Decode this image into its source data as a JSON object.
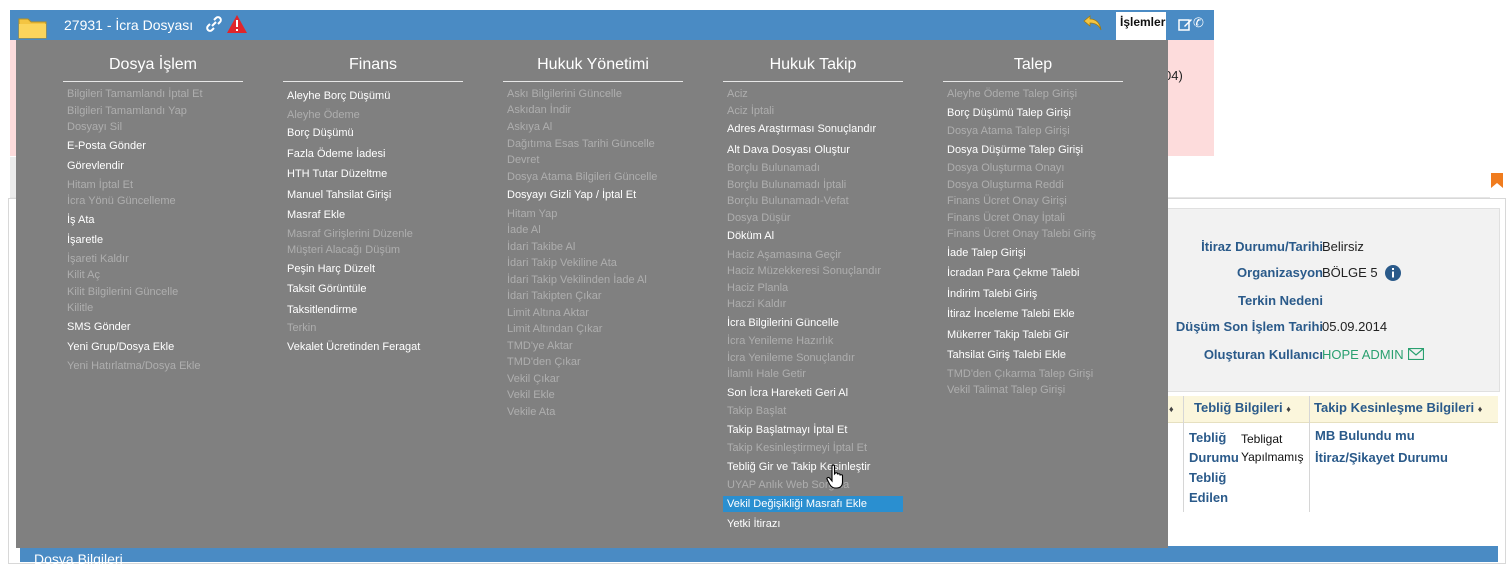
{
  "titlebar": {
    "title": "27931 - İcra Dosyası",
    "islemler_label": "İşlemler",
    "icons": [
      "folder-icon",
      "link-icon",
      "warning-icon",
      "undo-icon",
      "edit-icon",
      "phone-icon"
    ]
  },
  "pink_strip": {
    "text": "04)"
  },
  "info": {
    "rows": [
      {
        "label": "İtiraz Durumu/Tarihi",
        "value": "Belirsiz"
      },
      {
        "label": "Organizasyon",
        "value": "BÖLGE 5"
      },
      {
        "label": "Terkin Nedeni",
        "value": ""
      },
      {
        "label": "Düşüm Son İşlem Tarihi",
        "value": "05.09.2014"
      },
      {
        "label": "Oluşturan Kullanıcı",
        "value": "HOPE ADMIN"
      }
    ]
  },
  "table": {
    "headers": [
      "Tebliğ Bilgileri",
      "Takip Kesinleşme Bilgileri"
    ],
    "teblig_durumu_label": "Tebliğ Durumu",
    "teblig_durumu_value": "Tebligat Yapılmamış",
    "teblig_edilen_label": "Tebliğ Edilen",
    "mb_bulundu": "MB Bulundu mu",
    "itiraz_sikayet": "İtiraz/Şikayet Durumu"
  },
  "bottom_bar": {
    "title": "Dosya Bilgileri"
  },
  "menu": {
    "columns": [
      {
        "title": "Dosya İşlem",
        "items": [
          {
            "label": "Bilgileri Tamamlandı İptal Et",
            "enabled": false
          },
          {
            "label": "Bilgileri Tamamlandı Yap",
            "enabled": false
          },
          {
            "label": "Dosyayı Sil",
            "enabled": false
          },
          {
            "label": "E-Posta Gönder",
            "enabled": true
          },
          {
            "label": "Görevlendir",
            "enabled": true
          },
          {
            "label": "Hitam İptal Et",
            "enabled": false
          },
          {
            "label": "İcra Yönü Güncelleme",
            "enabled": false
          },
          {
            "label": "İş Ata",
            "enabled": true
          },
          {
            "label": "İşaretle",
            "enabled": true
          },
          {
            "label": "İşareti Kaldır",
            "enabled": false
          },
          {
            "label": "Kilit Aç",
            "enabled": false
          },
          {
            "label": "Kilit Bilgilerini Güncelle",
            "enabled": false
          },
          {
            "label": "Kilitle",
            "enabled": false
          },
          {
            "label": "SMS Gönder",
            "enabled": true
          },
          {
            "label": "Yeni Grup/Dosya Ekle",
            "enabled": true
          },
          {
            "label": "Yeni Hatırlatma/Dosya Ekle",
            "enabled": false
          }
        ]
      },
      {
        "title": "Finans",
        "items": [
          {
            "label": "Aleyhe Borç Düşümü",
            "enabled": true
          },
          {
            "label": "Aleyhe Ödeme",
            "enabled": false
          },
          {
            "label": "Borç Düşümü",
            "enabled": true
          },
          {
            "label": "Fazla Ödeme İadesi",
            "enabled": true
          },
          {
            "label": "HTH Tutar Düzeltme",
            "enabled": true
          },
          {
            "label": "Manuel Tahsilat Girişi",
            "enabled": true
          },
          {
            "label": "Masraf Ekle",
            "enabled": true
          },
          {
            "label": "Masraf Girişlerini Düzenle",
            "enabled": false
          },
          {
            "label": "Müşteri Alacağı Düşüm",
            "enabled": false
          },
          {
            "label": "Peşin Harç Düzelt",
            "enabled": true
          },
          {
            "label": "Taksit Görüntüle",
            "enabled": true
          },
          {
            "label": "Taksitlendirme",
            "enabled": true
          },
          {
            "label": "Terkin",
            "enabled": false
          },
          {
            "label": "Vekalet Ücretinden Feragat",
            "enabled": true
          }
        ]
      },
      {
        "title": "Hukuk Yönetimi",
        "items": [
          {
            "label": "Askı Bilgilerini Güncelle",
            "enabled": false
          },
          {
            "label": "Askıdan İndir",
            "enabled": false
          },
          {
            "label": "Askıya Al",
            "enabled": false
          },
          {
            "label": "Dağıtıma Esas Tarihi Güncelle",
            "enabled": false
          },
          {
            "label": "Devret",
            "enabled": false
          },
          {
            "label": "Dosya Atama Bilgileri Güncelle",
            "enabled": false
          },
          {
            "label": "Dosyayı Gizli Yap / İptal Et",
            "enabled": true
          },
          {
            "label": "Hitam Yap",
            "enabled": false
          },
          {
            "label": "İade Al",
            "enabled": false
          },
          {
            "label": "İdari Takibe Al",
            "enabled": false
          },
          {
            "label": "İdari Takip Vekiline Ata",
            "enabled": false
          },
          {
            "label": "İdari Takip Vekilinden İade Al",
            "enabled": false
          },
          {
            "label": "İdari Takipten Çıkar",
            "enabled": false
          },
          {
            "label": "Limit Altına Aktar",
            "enabled": false
          },
          {
            "label": "Limit Altından Çıkar",
            "enabled": false
          },
          {
            "label": "TMD'ye Aktar",
            "enabled": false
          },
          {
            "label": "TMD'den Çıkar",
            "enabled": false
          },
          {
            "label": "Vekil Çıkar",
            "enabled": false
          },
          {
            "label": "Vekil Ekle",
            "enabled": false
          },
          {
            "label": "Vekile Ata",
            "enabled": false
          }
        ]
      },
      {
        "title": "Hukuk Takip",
        "items": [
          {
            "label": "Aciz",
            "enabled": false
          },
          {
            "label": "Aciz İptali",
            "enabled": false
          },
          {
            "label": "Adres Araştırması Sonuçlandır",
            "enabled": true
          },
          {
            "label": "Alt Dava Dosyası Oluştur",
            "enabled": true
          },
          {
            "label": "Borçlu Bulunamadı",
            "enabled": false
          },
          {
            "label": "Borçlu Bulunamadı İptali",
            "enabled": false
          },
          {
            "label": "Borçlu Bulunamadı-Vefat",
            "enabled": false
          },
          {
            "label": "Dosya Düşür",
            "enabled": false
          },
          {
            "label": "Döküm Al",
            "enabled": true
          },
          {
            "label": "Haciz Aşamasına Geçir",
            "enabled": false
          },
          {
            "label": "Haciz Müzekkeresi Sonuçlandır",
            "enabled": false
          },
          {
            "label": "Haciz Planla",
            "enabled": false
          },
          {
            "label": "Haczi Kaldır",
            "enabled": false
          },
          {
            "label": "İcra Bilgilerini Güncelle",
            "enabled": true
          },
          {
            "label": "İcra Yenileme Hazırlık",
            "enabled": false
          },
          {
            "label": "İcra Yenileme Sonuçlandır",
            "enabled": false
          },
          {
            "label": "İlamlı Hale Getir",
            "enabled": false
          },
          {
            "label": "Son İcra Hareketi Geri Al",
            "enabled": true
          },
          {
            "label": "Takip Başlat",
            "enabled": false
          },
          {
            "label": "Takip Başlatmayı İptal Et",
            "enabled": true
          },
          {
            "label": "Takip Kesinleştirmeyi İptal Et",
            "enabled": false
          },
          {
            "label": "Tebliğ Gir ve Takip Kesinleştir",
            "enabled": true
          },
          {
            "label": "UYAP Anlık Web Sorgula",
            "enabled": false
          },
          {
            "label": "Vekil Değişikliği Masrafı Ekle",
            "enabled": true,
            "highlighted": true
          },
          {
            "label": "Yetki İtirazı",
            "enabled": true
          }
        ]
      },
      {
        "title": "Talep",
        "items": [
          {
            "label": "Aleyhe Ödeme Talep Girişi",
            "enabled": false
          },
          {
            "label": "Borç Düşümü Talep Girişi",
            "enabled": true
          },
          {
            "label": "Dosya Atama Talep Girişi",
            "enabled": false
          },
          {
            "label": "Dosya Düşürme Talep Girişi",
            "enabled": true
          },
          {
            "label": "Dosya Oluşturma Onayı",
            "enabled": false
          },
          {
            "label": "Dosya Oluşturma Reddi",
            "enabled": false
          },
          {
            "label": "Finans Ücret Onay Girişi",
            "enabled": false
          },
          {
            "label": "Finans Ücret Onay İptali",
            "enabled": false
          },
          {
            "label": "Finans Ücret Onay Talebi Giriş",
            "enabled": false
          },
          {
            "label": "İade Talep Girişi",
            "enabled": true
          },
          {
            "label": "İcradan Para Çekme Talebi",
            "enabled": true
          },
          {
            "label": "İndirim Talebi Giriş",
            "enabled": true
          },
          {
            "label": "İtiraz İnceleme Talebi Ekle",
            "enabled": true
          },
          {
            "label": "Mükerrer Takip Talebi Gir",
            "enabled": true
          },
          {
            "label": "Tahsilat Giriş Talebi Ekle",
            "enabled": true
          },
          {
            "label": "TMD'den Çıkarma Talep Girişi",
            "enabled": false
          },
          {
            "label": "Vekil Talimat Talep Girişi",
            "enabled": false
          }
        ]
      }
    ]
  }
}
